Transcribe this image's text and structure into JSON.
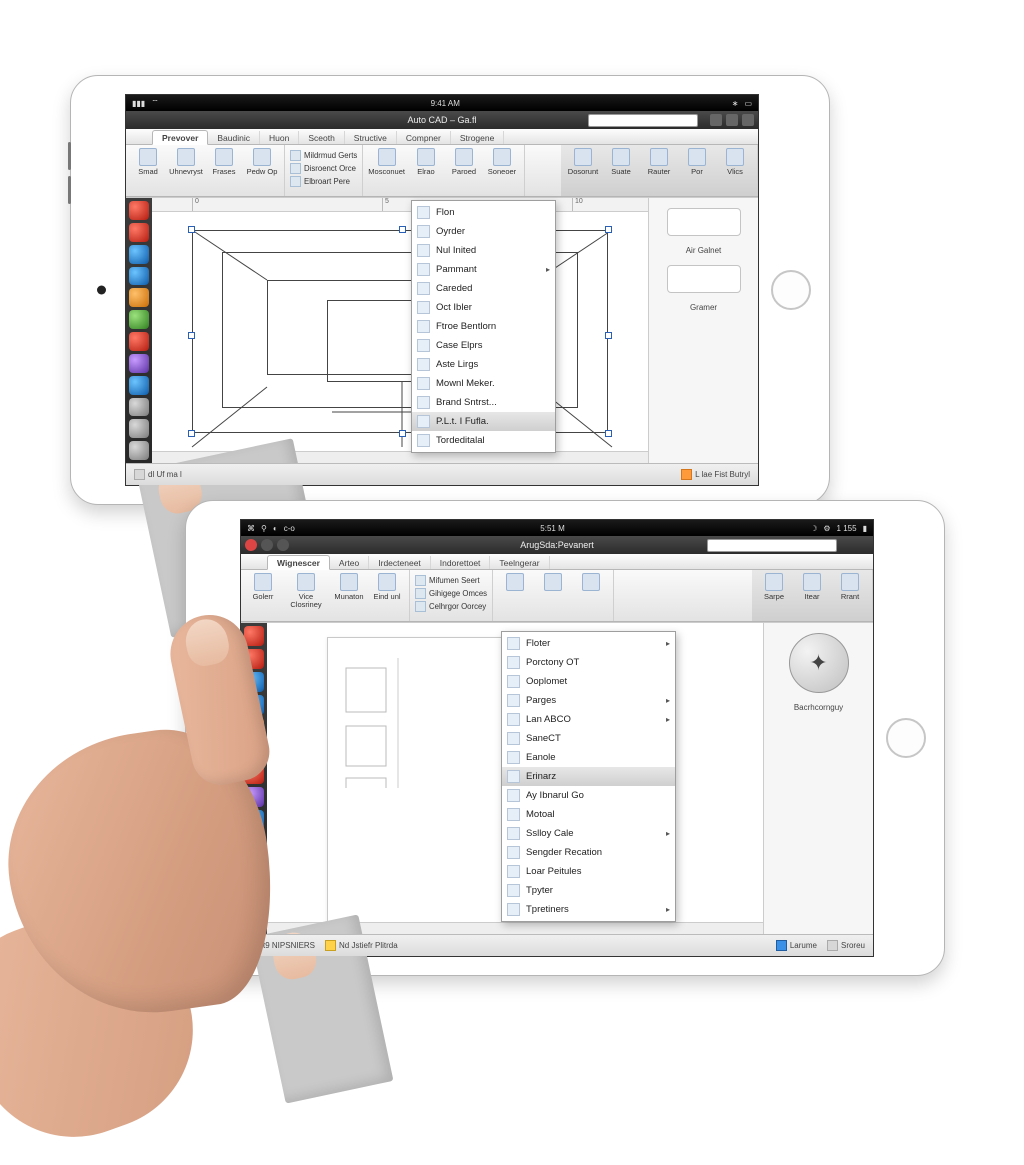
{
  "tablet1": {
    "status_time": "9:41 AM",
    "title": "Auto CAD – Ga.fl",
    "tabs": [
      "Prevover",
      "Baudinic",
      "Huon",
      "Sceoth",
      "Structive",
      "Compner",
      "Strogene"
    ],
    "active_tab": 0,
    "ribbon_large": [
      "Smad",
      "Uhnevryst",
      "Frases",
      "Pedw Op"
    ],
    "ribbon_minis": [
      "Mildrmud Gerts",
      "Disroenct Orce",
      "Elbroart Pere"
    ],
    "ribbon_mid": [
      "Mosconuet",
      "Elrao",
      "Paroed",
      "Soneoer"
    ],
    "ribbon_right": [
      "Dosorunt",
      "Suate",
      "Rauter",
      "Por",
      "Vlics"
    ],
    "menu": [
      "Flon",
      "Oyrder",
      "Nul Inited",
      "Pammant",
      "Careded",
      "Oct Ibler",
      "Ftroe Bentlorn",
      "Case Elprs",
      "Aste Lirgs",
      "Mownl Meker.",
      "Brand Sntrst...",
      "P.L.t. I Fufla.",
      "Tordeditalal"
    ],
    "menu_submenu_index": 3,
    "menu_selected_index": 11,
    "right_panel_1": "Air Galnet",
    "right_panel_2": "Gramer",
    "ruler_marks": [
      "0",
      "5",
      "10"
    ],
    "footer_left": "dl  Uf ma l",
    "footer_app_icon": "app-icon",
    "footer_right": "L lae   Fist Butryl",
    "scroll_caret": "▸"
  },
  "tablet2": {
    "status_time": "5:51 M",
    "status_right": "1 155",
    "title": "ArugSda:Pevanert",
    "tabs": [
      "Wignescer",
      "Arteo",
      "Irdecteneet",
      "Indorettoet",
      "Teelngerar"
    ],
    "active_tab": 0,
    "ribbon_large": [
      "Golerr",
      "Vice Closriney",
      "Munaton",
      "Eind unl"
    ],
    "ribbon_minis": [
      "Mifumen Seert",
      "Gihigege Omces",
      "Celhrgor Oorcey"
    ],
    "ribbon_mid": [
      "",
      "",
      ""
    ],
    "ribbon_right": [
      "Sarpe",
      "Itear",
      "Rrant"
    ],
    "menu": [
      "Floter",
      "Porctony OT",
      "Ooplomet",
      "Parges",
      "Lan ABCO",
      "SaneCT",
      "Eanole",
      "Erinarz",
      "Ay Ibnarul Go",
      "Motoal",
      "Sslloy Cale",
      "Sengder Recation",
      "Loar Peitules",
      "Tpyter",
      "Tpretiners"
    ],
    "menu_submenu_idx": [
      0,
      3,
      4,
      10,
      14
    ],
    "menu_selected_index": 7,
    "right_panel_label": "Bacrhcornguy",
    "footer_left": "t9  NIPSNIERS",
    "footer_mid": "Nd Jstiefr Plitrda",
    "footer_right_1": "Larume",
    "footer_right_2": "Sroreu"
  }
}
